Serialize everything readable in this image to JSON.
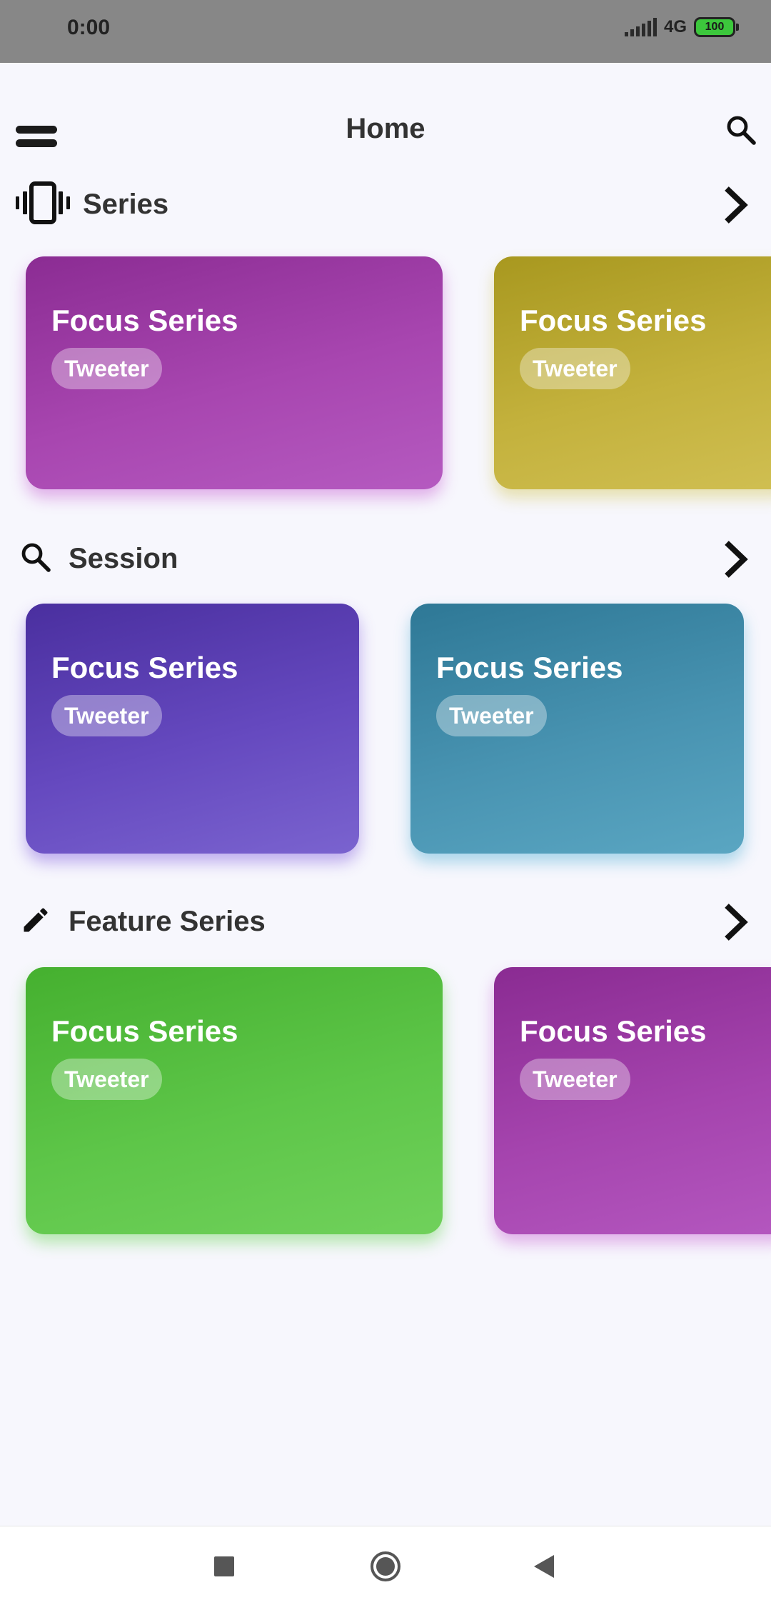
{
  "status_bar": {
    "time": "0:00",
    "network": "4G",
    "battery": "100"
  },
  "app_bar": {
    "title": "Home",
    "menu_icon": "menu-icon",
    "search_icon": "search-icon"
  },
  "sections": [
    {
      "title": "Series",
      "icon": "vibration-icon",
      "cards": [
        {
          "title": "Focus Series",
          "tag": "Tweeter",
          "color": "#8E2C94"
        },
        {
          "title": "Focus Series",
          "tag": "Tweeter",
          "color": "#A89A28"
        }
      ]
    },
    {
      "title": "Session",
      "icon": "search-icon",
      "cards": [
        {
          "title": "Focus Series",
          "tag": "Tweeter",
          "color": "#4930A0"
        },
        {
          "title": "Focus Series",
          "tag": "Tweeter",
          "color": "#2F7F9F"
        }
      ]
    },
    {
      "title": "Feature Series",
      "icon": "pencil-icon",
      "cards": [
        {
          "title": "Focus Series",
          "tag": "Tweeter",
          "color": "#4CB333"
        },
        {
          "title": "Focus Series",
          "tag": "Tweeter",
          "color": "#8E2C94"
        }
      ]
    }
  ],
  "colors": {
    "background": "#F7F7FD",
    "status_bar": "#878787",
    "text": "#333333"
  }
}
